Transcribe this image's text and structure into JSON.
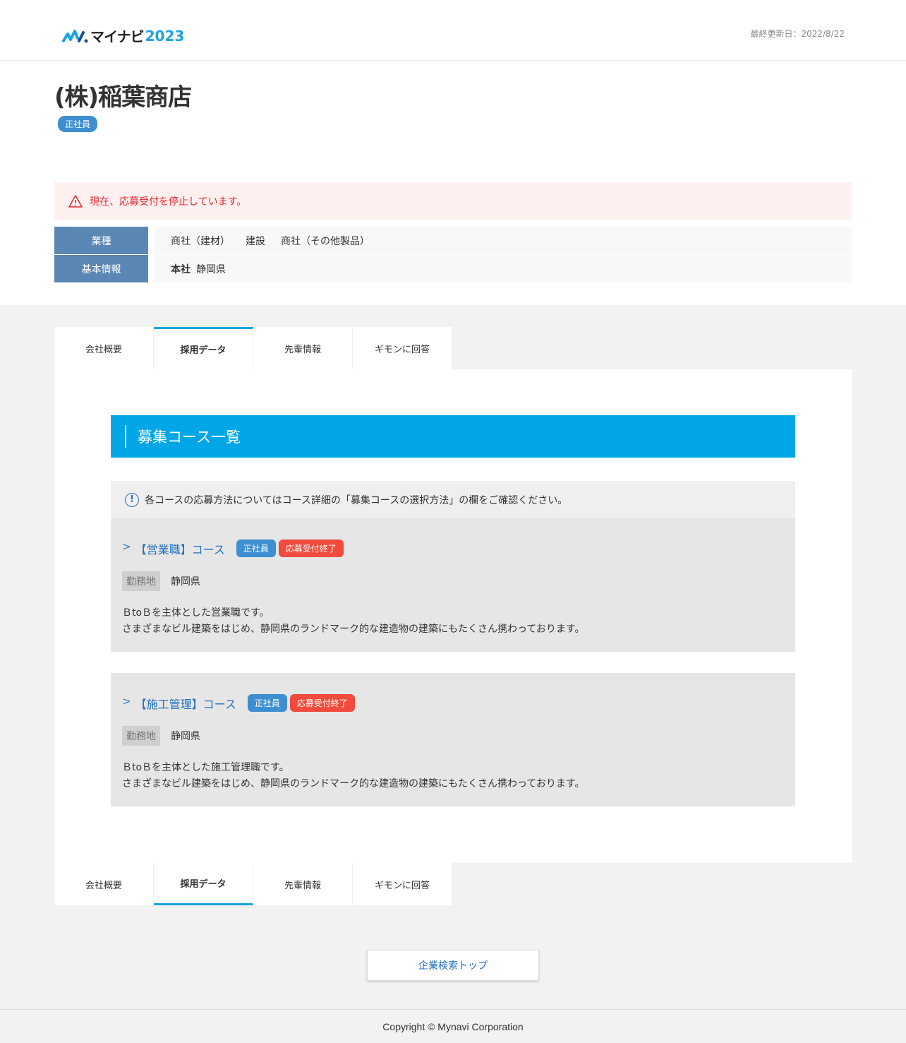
{
  "header": {
    "logo_text": "マイナビ",
    "logo_year": "2023",
    "updated": "最終更新日：2022/8/22"
  },
  "company": {
    "name": "(株)稲葉商店",
    "employment_badge": "正社員"
  },
  "alert": {
    "text": "現在、応募受付を停止しています。"
  },
  "info": {
    "industry_label": "業種",
    "industries": [
      "商社（建材）",
      "建設",
      "商社（その他製品）"
    ],
    "basic_label": "基本情報",
    "hq_label": "本社",
    "hq_value": "静岡県"
  },
  "tabs": [
    "会社概要",
    "採用データ",
    "先輩情報",
    "ギモンに回答"
  ],
  "section": {
    "title": "募集コース一覧",
    "notice": "各コースの応募方法についてはコース詳細の「募集コースの選択方法」の欄をご確認ください。"
  },
  "courses": [
    {
      "title": "【営業職】コース",
      "badge_type": "正社員",
      "badge_status": "応募受付終了",
      "loc_label": "勤務地",
      "loc_value": "静岡県",
      "desc1": "ＢtoＢを主体とした営業職です。",
      "desc2": "さまざまなビル建築をはじめ、静岡県のランドマーク的な建造物の建築にもたくさん携わっております。"
    },
    {
      "title": "【施工管理】コース",
      "badge_type": "正社員",
      "badge_status": "応募受付終了",
      "loc_label": "勤務地",
      "loc_value": "静岡県",
      "desc1": "ＢtoＢを主体とした施工管理職です。",
      "desc2": "さまざまなビル建築をはじめ、静岡県のランドマーク的な建造物の建築にもたくさん携わっております。"
    }
  ],
  "top_button": "企業検索トップ",
  "footer": "Copyright © Mynavi Corporation",
  "colors": {
    "accent": "#00a6e6",
    "link": "#1f6fc0",
    "alert": "#e0282e",
    "badge_blue": "#3d8fd1",
    "badge_red": "#f04b3c"
  }
}
